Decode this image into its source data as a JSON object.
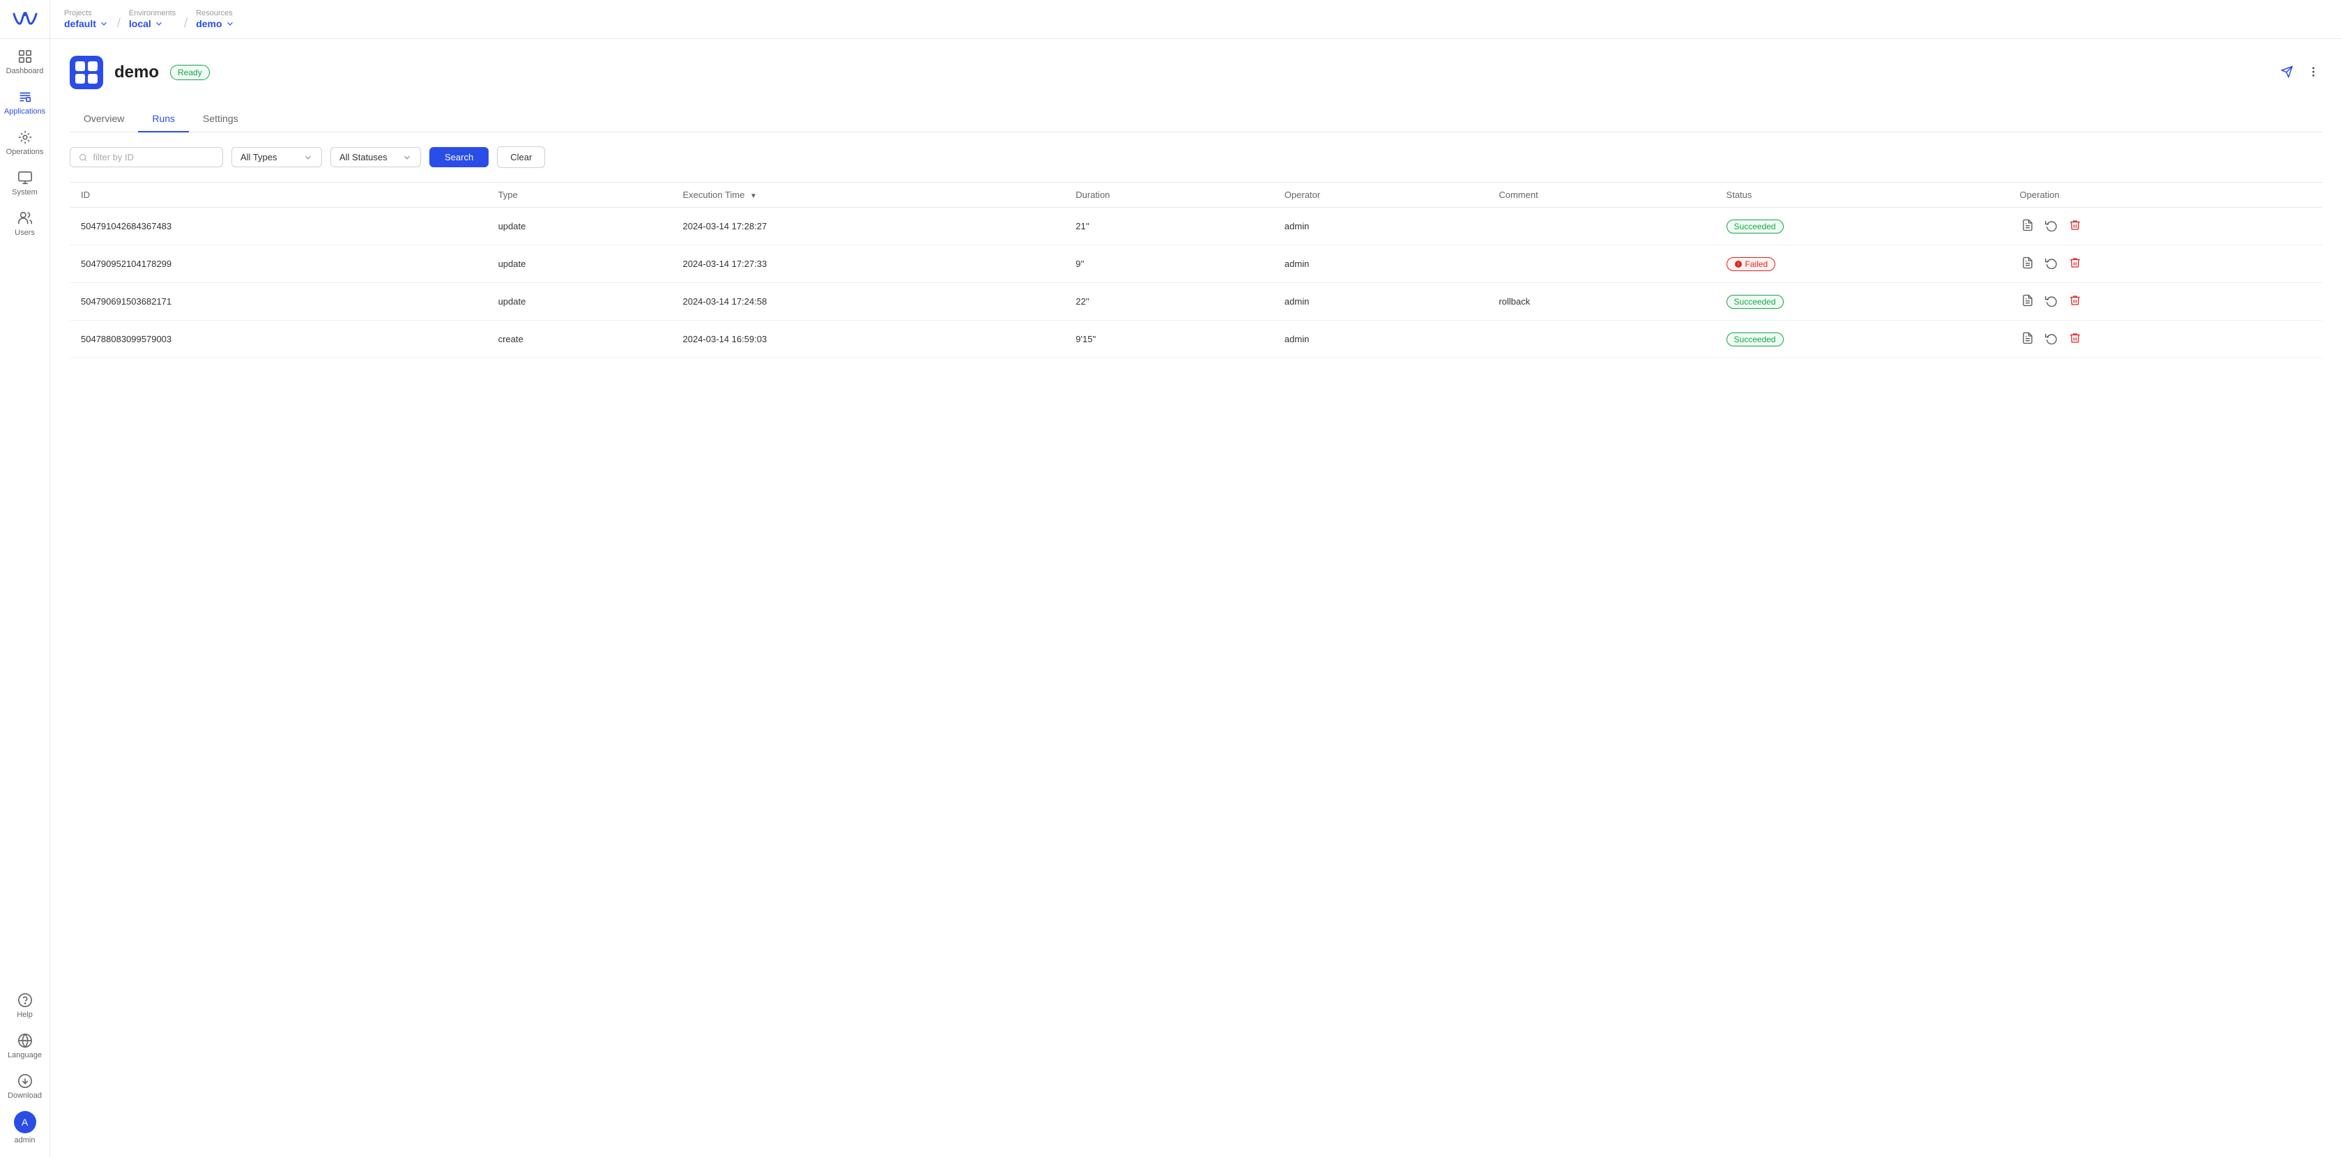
{
  "brand": {
    "name": "Walrus"
  },
  "sidebar": {
    "items": [
      {
        "id": "dashboard",
        "label": "Dashboard",
        "active": false
      },
      {
        "id": "applications",
        "label": "Applications",
        "active": true
      },
      {
        "id": "operations",
        "label": "Operations",
        "active": false
      },
      {
        "id": "system",
        "label": "System",
        "active": false
      },
      {
        "id": "users",
        "label": "Users",
        "active": false
      }
    ],
    "bottom": [
      {
        "id": "help",
        "label": "Help"
      },
      {
        "id": "language",
        "label": "Language"
      },
      {
        "id": "download",
        "label": "Download"
      }
    ],
    "user": {
      "name": "admin",
      "initial": "A"
    }
  },
  "topbar": {
    "projects_label": "Projects",
    "projects_value": "default",
    "environments_label": "Environments",
    "environments_value": "local",
    "resources_label": "Resources",
    "resources_value": "demo"
  },
  "app": {
    "name": "demo",
    "status": "Ready",
    "status_class": "ready"
  },
  "tabs": [
    {
      "id": "overview",
      "label": "Overview",
      "active": false
    },
    {
      "id": "runs",
      "label": "Runs",
      "active": true
    },
    {
      "id": "settings",
      "label": "Settings",
      "active": false
    }
  ],
  "filters": {
    "id_placeholder": "filter by ID",
    "types_label": "All Types",
    "statuses_label": "All Statuses",
    "search_label": "Search",
    "clear_label": "Clear"
  },
  "table": {
    "columns": [
      "ID",
      "Type",
      "Execution Time",
      "Duration",
      "Operator",
      "Comment",
      "Status",
      "Operation"
    ],
    "rows": [
      {
        "id": "504791042684367483",
        "type": "update",
        "execution_time": "2024-03-14 17:28:27",
        "duration": "21''",
        "operator": "admin",
        "comment": "",
        "status": "Succeeded",
        "status_class": "succeeded"
      },
      {
        "id": "504790952104178299",
        "type": "update",
        "execution_time": "2024-03-14 17:27:33",
        "duration": "9''",
        "operator": "admin",
        "comment": "",
        "status": "Failed",
        "status_class": "failed"
      },
      {
        "id": "504790691503682171",
        "type": "update",
        "execution_time": "2024-03-14 17:24:58",
        "duration": "22''",
        "operator": "admin",
        "comment": "rollback",
        "status": "Succeeded",
        "status_class": "succeeded"
      },
      {
        "id": "504788083099579003",
        "type": "create",
        "execution_time": "2024-03-14 16:59:03",
        "duration": "9'15''",
        "operator": "admin",
        "comment": "",
        "status": "Succeeded",
        "status_class": "succeeded"
      }
    ]
  }
}
